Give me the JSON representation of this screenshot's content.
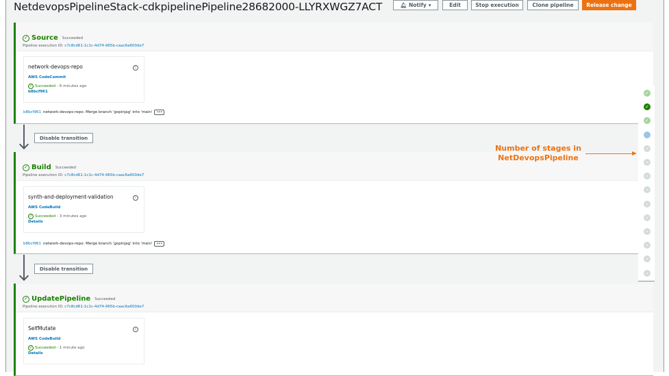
{
  "header": {
    "title": "NetdevopsPipelineStack-cdkpipelinePipeline28682000-LLYRXWGZ7ACT",
    "buttons": {
      "notify": "Notify",
      "edit": "Edit",
      "stop": "Stop execution",
      "clone": "Clone pipeline",
      "release": "Release change"
    }
  },
  "exec_label": "Pipeline execution ID:",
  "exec_id": "c7c8cd61-1c1c-4d74-965b-caac6a600de7",
  "transition_label": "Disable transition",
  "stages": [
    {
      "name": "Source",
      "status": "Succeeded",
      "action": {
        "name": "network-devops-repo",
        "provider": "AWS CodeCommit",
        "status": "Succeeded",
        "time": "- 6 minutes ago",
        "sub": "b8bcf961"
      },
      "commit_id": "b8bcf961",
      "commit_msg": "network-devops-repo: Merge branch 'gopinjag' into 'main'"
    },
    {
      "name": "Build",
      "status": "Succeeded",
      "action": {
        "name": "synth-and-deployment-validation",
        "provider": "AWS CodeBuild",
        "status": "Succeeded",
        "time": "- 3 minutes ago",
        "sub": "Details"
      },
      "commit_id": "b8bcf961",
      "commit_msg": "network-devops-repo: Merge branch 'gopinjag' into 'main'"
    },
    {
      "name": "UpdatePipeline",
      "status": "Succeeded",
      "action": {
        "name": "SelfMutate",
        "provider": "AWS CodeBuild",
        "status": "Succeeded",
        "time": "- 1 minute ago",
        "sub": "Details"
      }
    }
  ],
  "stage_indicators": [
    "succeeded-light",
    "succeeded-current",
    "succeeded-light",
    "in-progress",
    "pending",
    "pending",
    "pending",
    "pending",
    "pending",
    "pending",
    "pending",
    "pending",
    "pending",
    "pending"
  ],
  "annotation": "Number of stages in NetDevopsPipeline",
  "colors": {
    "success": "#1d8102",
    "accent": "#ec7211",
    "link": "#0073bb"
  }
}
